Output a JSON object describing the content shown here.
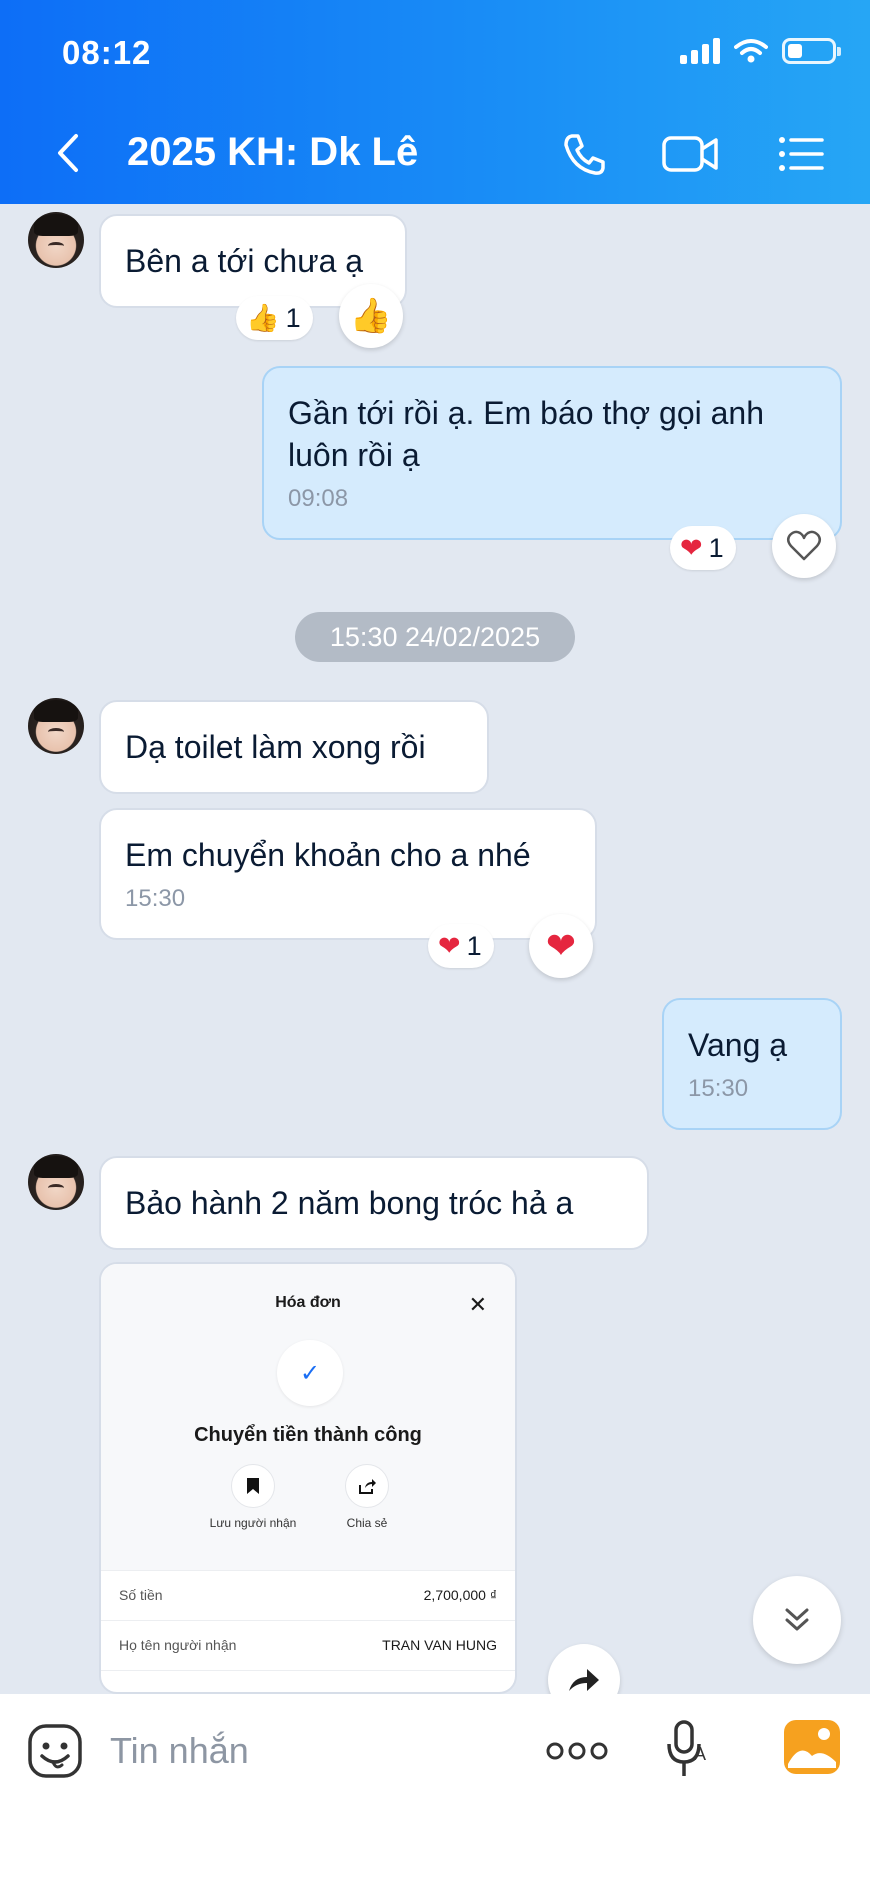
{
  "status_bar": {
    "time": "08:12"
  },
  "header": {
    "title": "2025 KH: Dk Lê"
  },
  "messages": {
    "m1": {
      "text": "Bên a tới chưa ạ",
      "reaction_count": "1"
    },
    "m2": {
      "text": "Gần tới rồi ạ. Em báo thợ gọi anh luôn rồi ạ",
      "time": "09:08",
      "reaction_count": "1"
    },
    "date_separator": "15:30 24/02/2025",
    "m3": {
      "text": "Dạ toilet làm xong rồi"
    },
    "m4": {
      "text": "Em chuyển khoản cho a nhé",
      "time": "15:30",
      "reaction_count": "1"
    },
    "m5": {
      "text": "Vang ạ",
      "time": "15:30"
    },
    "m6": {
      "text": "Bảo hành 2 năm bong tróc hả a"
    }
  },
  "receipt": {
    "title": "Hóa đơn",
    "close": "✕",
    "status": "Chuyển tiền thành công",
    "save_label": "Lưu người nhận",
    "share_label": "Chia sẻ",
    "rows": [
      {
        "label": "Số tiền",
        "value": "2,700,000 ₫"
      },
      {
        "label": "Họ tên người nhận",
        "value": "TRAN VAN HUNG"
      }
    ]
  },
  "composer": {
    "placeholder": "Tin nhắn"
  },
  "colors": {
    "header": "#1a8ff6",
    "mine_bubble": "#d5ebfd",
    "background": "#e2e8f1",
    "heart": "#e5263f",
    "gallery": "#f6a11f"
  }
}
